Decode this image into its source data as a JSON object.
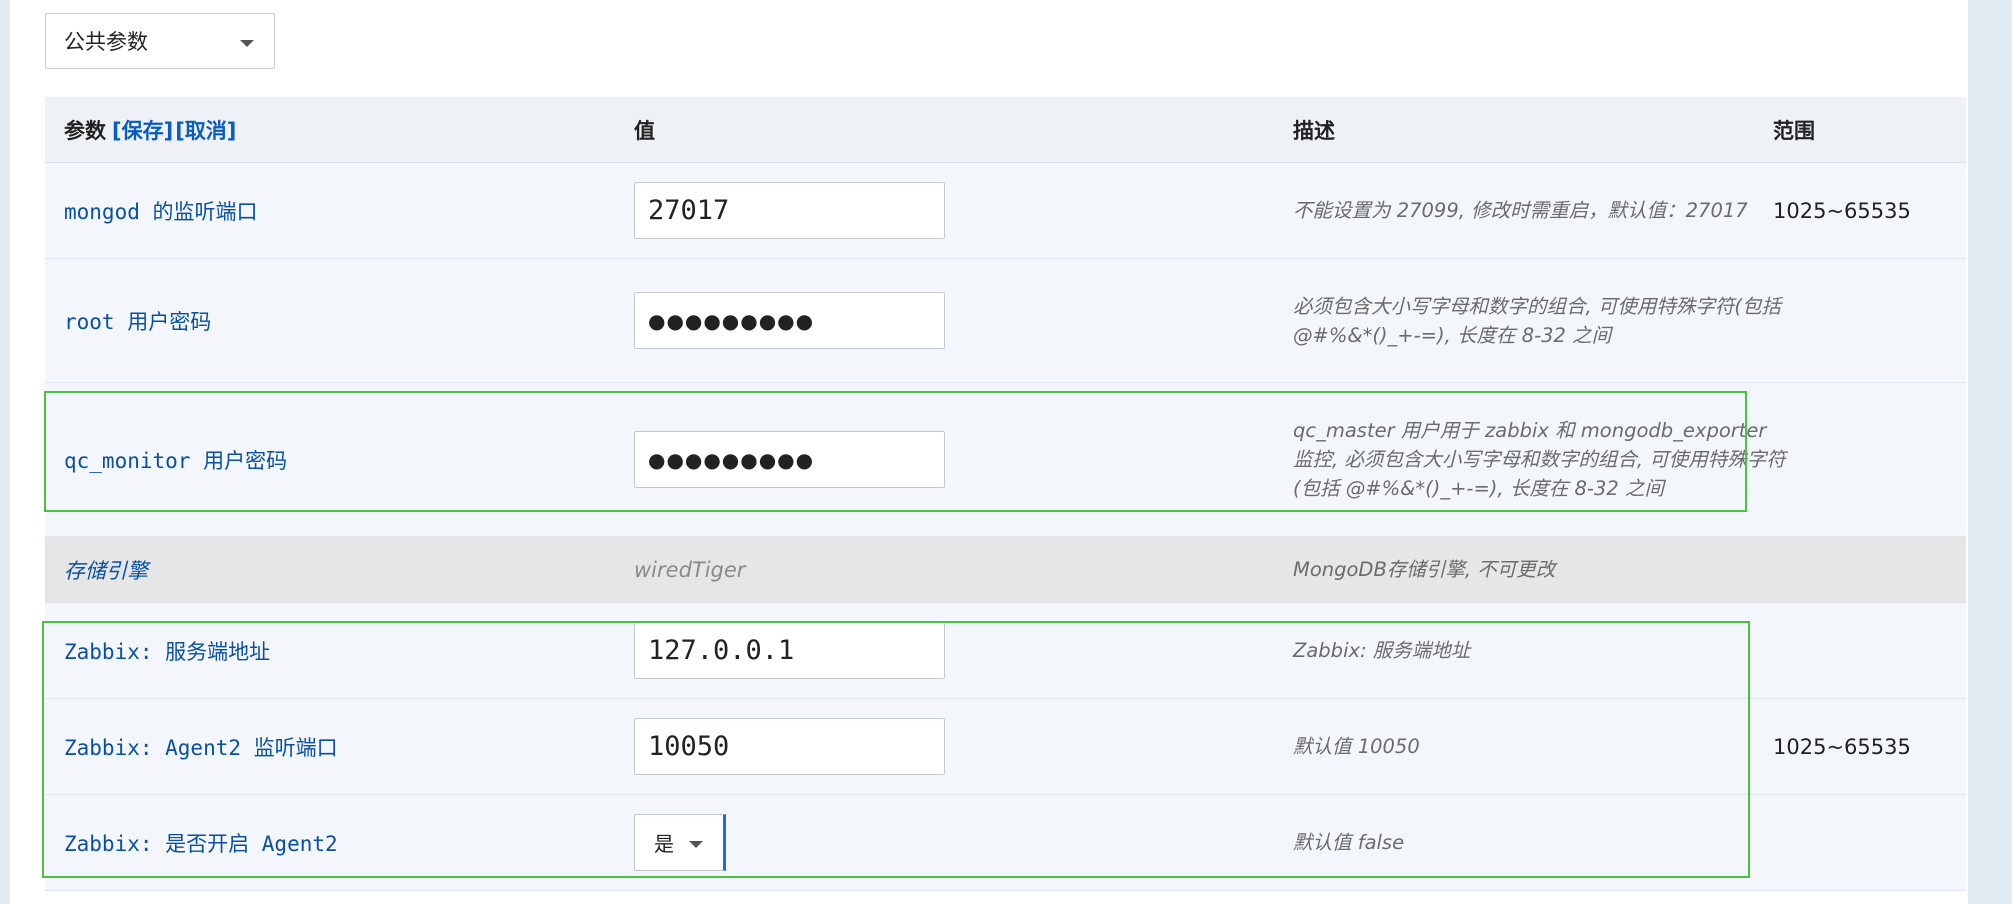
{
  "param_group": {
    "selected": "公共参数"
  },
  "table": {
    "headers": {
      "param": "参数",
      "save": "[保存]",
      "cancel": "[取消]",
      "value": "值",
      "description": "描述",
      "range": "范围"
    },
    "rows": [
      {
        "name": "mongod 的监听端口",
        "value": "27017",
        "description": "不能设置为 27099, 修改时需重启，默认值：27017",
        "range": "1025~65535"
      },
      {
        "name": "root 用户密码",
        "value": "●●●●●●●●●",
        "description": "必须包含大小写字母和数字的组合, 可使用特殊字符(包括 @#%&*()_+-=), 长度在 8-32 之间",
        "range": ""
      },
      {
        "name": "qc_monitor 用户密码",
        "value": "●●●●●●●●●",
        "description": "qc_master 用户用于 zabbix 和 mongodb_exporter 监控, 必须包含大小写字母和数字的组合, 可使用特殊字符(包括 @#%&*()_+-=), 长度在 8-32 之间",
        "range": ""
      },
      {
        "name": "存储引擎",
        "value": "wiredTiger",
        "description": "MongoDB存储引擎, 不可更改",
        "range": ""
      },
      {
        "name": "Zabbix: 服务端地址",
        "value": "127.0.0.1",
        "description": "Zabbix: 服务端地址",
        "range": ""
      },
      {
        "name": "Zabbix: Agent2 监听端口",
        "value": "10050",
        "description": "默认值 10050",
        "range": "1025~65535"
      },
      {
        "name": "Zabbix: 是否开启 Agent2",
        "value": "是",
        "description": "默认值 false",
        "range": ""
      }
    ]
  },
  "colors": {
    "link": "#0a5cc0",
    "highlight": "#49c244",
    "row_bg": "#f3f7fb",
    "readonly_bg": "#e6e6e6"
  }
}
